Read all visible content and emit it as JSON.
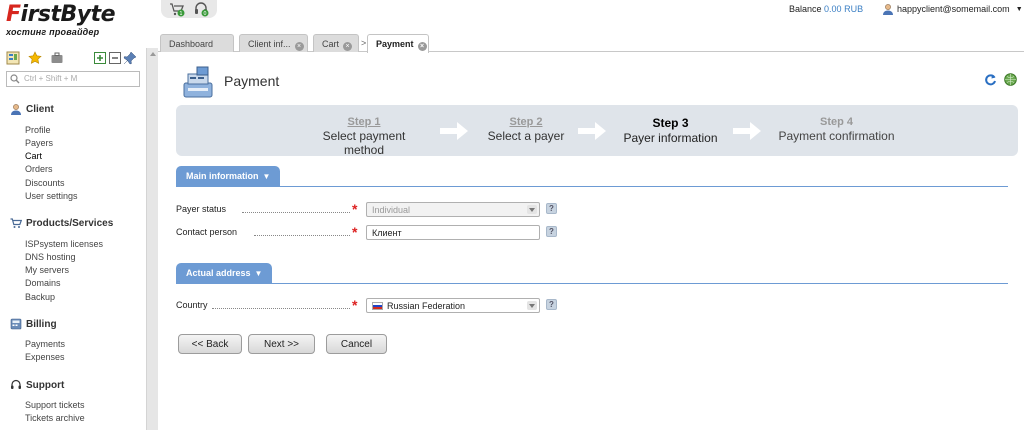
{
  "brand": {
    "logo_first": "F",
    "logo_rest": "irstByte",
    "logo_sub": "хостинг провайдер"
  },
  "header": {
    "balance_label": "Balance",
    "balance_value": "0.00 RUB",
    "user_email": "happyclient@somemail.com"
  },
  "tabs": [
    {
      "label": "Dashboard"
    },
    {
      "label": "Client inf..."
    },
    {
      "label": "Cart"
    },
    {
      "label": "Payment"
    }
  ],
  "tab_separator": ">",
  "sidebar": {
    "search_placeholder": "Ctrl + Shift + M",
    "sections": [
      {
        "title": "Client",
        "items": [
          "Profile",
          "Payers",
          "Cart",
          "Orders",
          "Discounts",
          "User settings"
        ]
      },
      {
        "title": "Products/Services",
        "items": [
          "ISPsystem licenses",
          "DNS hosting",
          "My servers",
          "Domains",
          "Backup"
        ]
      },
      {
        "title": "Billing",
        "items": [
          "Payments",
          "Expenses"
        ]
      },
      {
        "title": "Support",
        "items": [
          "Support tickets",
          "Tickets archive"
        ]
      }
    ]
  },
  "page": {
    "title": "Payment"
  },
  "steps": [
    {
      "num": "Step 1",
      "text": "Select payment method"
    },
    {
      "num": "Step 2",
      "text": "Select a payer"
    },
    {
      "num": "Step 3",
      "text": "Payer information"
    },
    {
      "num": "Step 4",
      "text": "Payment confirmation"
    }
  ],
  "sections": {
    "main_info": "Main information",
    "actual_address": "Actual address"
  },
  "fields": {
    "payer_status": {
      "label": "Payer status",
      "value": "Individual"
    },
    "contact_person": {
      "label": "Contact person",
      "value": "Клиент"
    },
    "country": {
      "label": "Country",
      "value": "Russian Federation"
    }
  },
  "help_glyph": "?",
  "required_glyph": "*",
  "buttons": {
    "back": "<< Back",
    "next": "Next >>",
    "cancel": "Cancel"
  },
  "colors": {
    "accent_blue": "#6d9bd4",
    "logo_red": "#d7261e",
    "steps_bg": "#dfe4ea"
  }
}
